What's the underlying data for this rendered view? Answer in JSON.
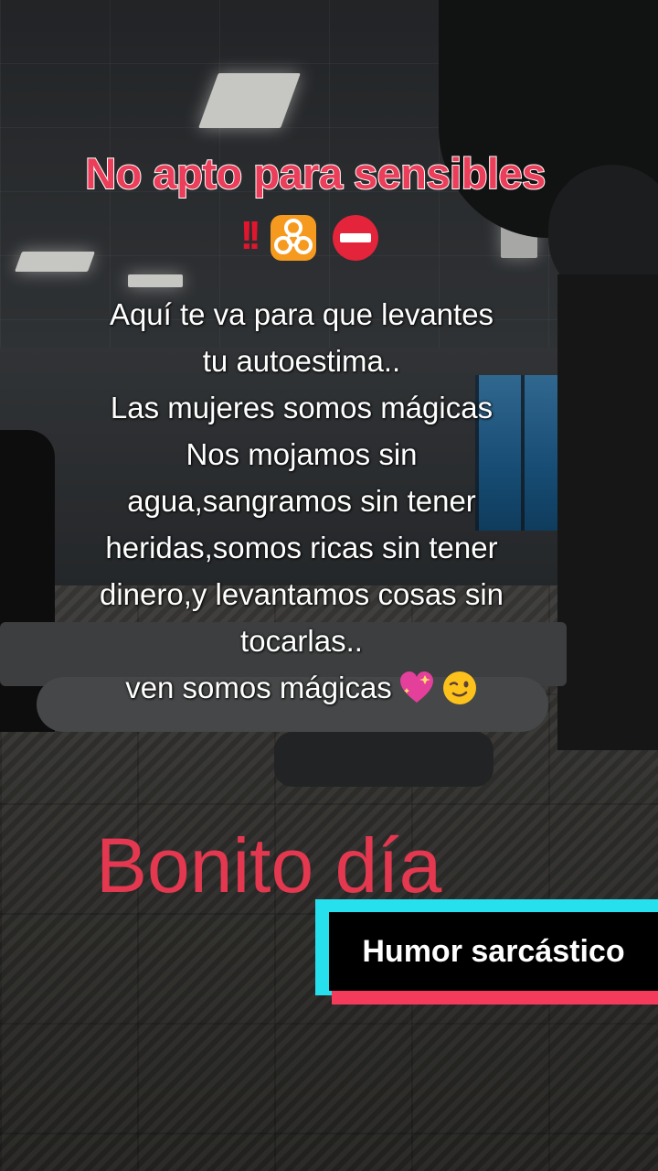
{
  "overlay": {
    "title": "No apto para sensibles",
    "title_emojis": [
      "double-exclamation",
      "biohazard",
      "no-entry"
    ],
    "body_lines": [
      "Aquí te va para que levantes",
      "tu autoestima..",
      "Las mujeres somos mágicas",
      "Nos mojamos sin",
      "agua,sangramos sin tener",
      "heridas,somos ricas sin tener",
      "dinero,y levantamos cosas sin",
      "tocarlas.."
    ],
    "last_line": "ven somos mágicas",
    "last_line_emojis": [
      "sparkling-heart",
      "winking-face"
    ],
    "greeting": "Bonito día",
    "badge": "Humor sarcástico"
  },
  "colors": {
    "title": "#ea3e5a",
    "greeting": "#e3384f",
    "badge_cyan": "#27e0ee",
    "badge_red": "#f43b5c",
    "badge_black": "#000000"
  }
}
